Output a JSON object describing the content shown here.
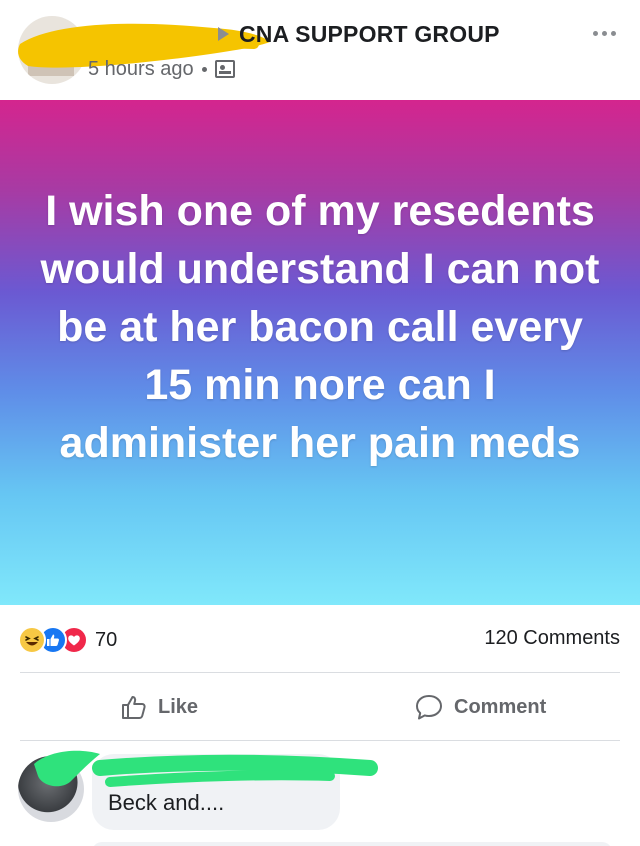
{
  "post": {
    "author_visible_fragment": "...",
    "group_name": "CNA SUPPORT GROUP",
    "time_ago": "5 hours ago",
    "body_text": "I wish one of my resedents would understand I can not be at her bacon call every 15 min nore can I administer her pain meds",
    "gradient_colors": [
      "#d4258e",
      "#6b59d2",
      "#80e8fb"
    ]
  },
  "icons": {
    "more": "more-dots-icon",
    "arrow": "arrow-right-icon",
    "privacy": "group-members-icon",
    "like": "thumbs-up-icon",
    "comment": "speech-bubble-icon"
  },
  "reactions": {
    "types": [
      "haha",
      "like",
      "love"
    ],
    "count": "70",
    "comments_label": "120 Comments"
  },
  "actions": {
    "like_label": "Like",
    "comment_label": "Comment"
  },
  "comment": {
    "text": "Beck and...."
  },
  "colors": {
    "text_primary": "#1c1e21",
    "text_secondary": "#65676b",
    "like_blue": "#1877f2",
    "love_red": "#f0284a",
    "haha_yellow": "#f7c844",
    "redaction_yellow": "#f5c400",
    "redaction_green": "#2fe27c"
  }
}
